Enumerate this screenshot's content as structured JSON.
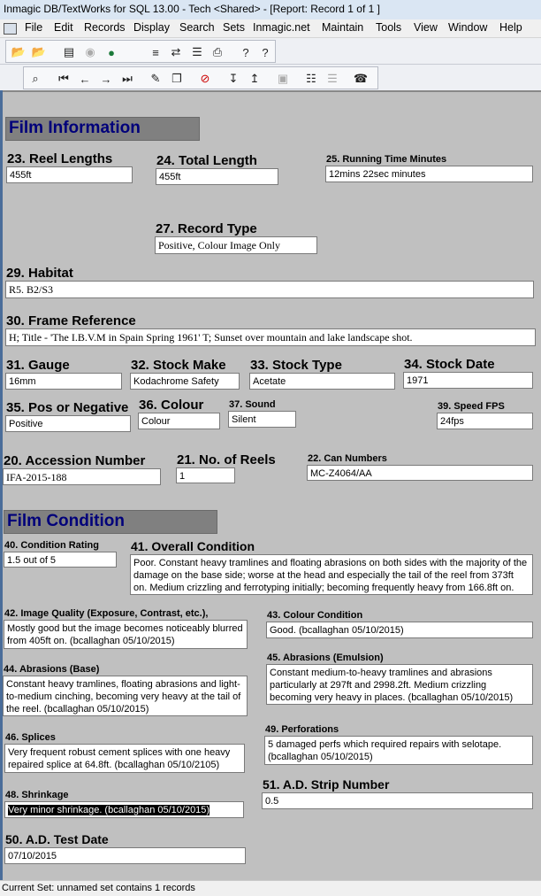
{
  "window": {
    "title": "Inmagic DB/TextWorks for SQL 13.00  -  Tech <Shared>  -  [Report: Record 1 of 1 ]"
  },
  "menu": [
    "File",
    "Edit",
    "Records",
    "Display",
    "Search",
    "Sets",
    "Inmagic.net",
    "Maintain",
    "Tools",
    "View",
    "Window",
    "Help"
  ],
  "toolbar1": [
    "open-folder-icon",
    "open-folder-icon",
    "form-icon",
    "eye-icon",
    "globe-icon",
    "query-icon",
    "switch-icon",
    "report-icon",
    "print-icon",
    "help-icon",
    "context-help-icon"
  ],
  "toolbar2": [
    "zoom-icon",
    "first-record-icon",
    "previous-record-icon",
    "next-record-icon",
    "last-record-icon",
    "edit-icon",
    "new-record-icon",
    "delete-icon",
    "export-icon",
    "import-icon",
    "copy-icon",
    "report-list-icon",
    "sort-icon",
    "phone-icon"
  ],
  "sections": {
    "film_information": "Film Information",
    "film_condition": "Film Condition"
  },
  "fields": {
    "reel_lengths": {
      "label": "23. Reel Lengths",
      "value": "455ft"
    },
    "total_length": {
      "label": "24. Total Length",
      "value": "455ft"
    },
    "running_time": {
      "label": "25. Running Time Minutes",
      "value": "12mins 22sec minutes"
    },
    "record_type": {
      "label": "27. Record Type",
      "value": "Positive, Colour Image Only"
    },
    "habitat": {
      "label": "29. Habitat",
      "value": "R5. B2/S3"
    },
    "frame_reference": {
      "label": "30. Frame Reference",
      "value": "H; Title - 'The I.B.V.M in Spain Spring 1961' T; Sunset over mountain and lake landscape shot."
    },
    "gauge": {
      "label": "31. Gauge",
      "value": "16mm"
    },
    "stock_make": {
      "label": "32. Stock Make",
      "value": "Kodachrome Safety Film"
    },
    "stock_type": {
      "label": "33. Stock Type",
      "value": "Acetate"
    },
    "stock_date": {
      "label": "34. Stock Date",
      "value": "1971"
    },
    "pos_or_negative": {
      "label": "35. Pos or Negative",
      "value": "Positive"
    },
    "colour": {
      "label": "36. Colour",
      "value": "Colour"
    },
    "sound": {
      "label": "37. Sound",
      "value": "Silent"
    },
    "speed_fps": {
      "label": "39. Speed FPS",
      "value": "24fps"
    },
    "accession_number": {
      "label": "20. Accession Number",
      "value": "IFA-2015-188"
    },
    "no_of_reels": {
      "label": "21. No. of Reels",
      "value": "1"
    },
    "can_numbers": {
      "label": "22. Can Numbers",
      "value": "MC-Z4064/AA"
    },
    "condition_rating": {
      "label": "40. Condition Rating",
      "value": "1.5 out of 5"
    },
    "overall_condition": {
      "label": "41. Overall Condition",
      "value": "Poor. Constant heavy tramlines and floating abrasions on both sides with the majority of the damage on the base side; worse at the head and especially the tail of the reel from 373ft on. Medium crizzling and ferrotyping initially; becoming frequently heavy from 166.8ft on."
    },
    "image_quality": {
      "label": "42. Image Quality (Exposure, Contrast, etc.),",
      "value": "Mostly good but the image becomes noticeably blurred from 405ft on. (bcallaghan 05/10/2015)"
    },
    "colour_condition": {
      "label": "43. Colour Condition",
      "value": "Good. (bcallaghan 05/10/2015)"
    },
    "abrasions_base": {
      "label": "44. Abrasions (Base)",
      "value": "Constant heavy tramlines, floating abrasions and light-to-medium cinching, becoming very heavy at the tail of the reel. (bcallaghan 05/10/2015)"
    },
    "abrasions_emulsion": {
      "label": "45. Abrasions (Emulsion)",
      "value": "Constant medium-to-heavy tramlines and abrasions particularly at 297ft and 2998.2ft. Medium crizzling becoming very heavy in places. (bcallaghan 05/10/2015)"
    },
    "splices": {
      "label": "46. Splices",
      "value": "Very frequent robust cement splices with one heavy repaired splice at 64.8ft. (bcallaghan 05/10/2105)"
    },
    "perforations": {
      "label": "49. Perforations",
      "value": "5 damaged perfs which required repairs with selotape. (bcallaghan 05/10/2015)"
    },
    "shrinkage": {
      "label": "48. Shrinkage",
      "value": "Very minor shrinkage. (bcallaghan 05/10/2015)"
    },
    "ad_strip_number": {
      "label": "51. A.D. Strip Number",
      "value": "0.5"
    },
    "ad_test_date": {
      "label": "50. A.D. Test Date",
      "value": "07/10/2015"
    }
  },
  "status": {
    "text": "Current Set: unnamed set contains 1 records"
  }
}
